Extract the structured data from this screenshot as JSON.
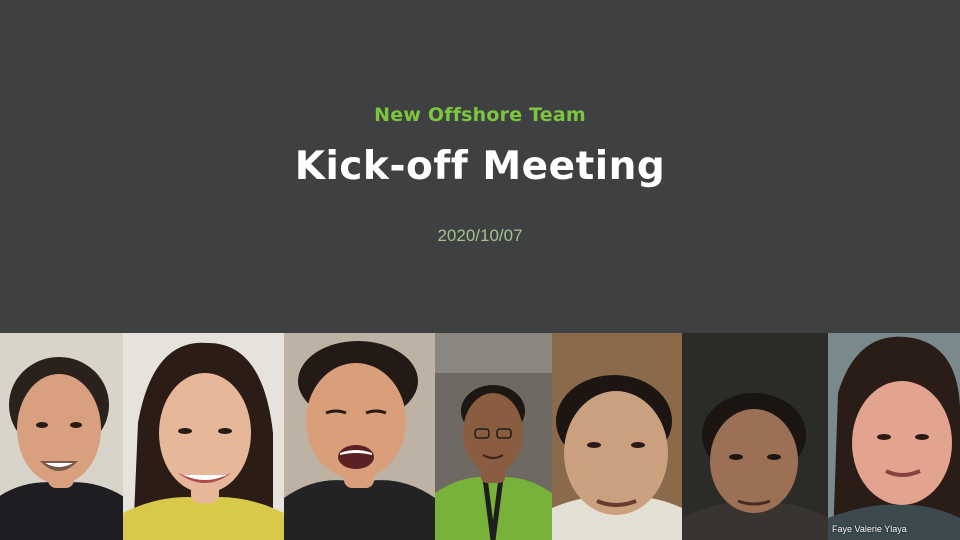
{
  "slide": {
    "subtitle": "New Offshore Team",
    "title": "Kick-off Meeting",
    "date": "2020/10/07"
  },
  "participants": [
    {
      "id": "p1",
      "name": "",
      "bg": "#d9d4c9",
      "skin": "#d8a07e",
      "hair": "#2a211c",
      "shirt": "#1e1e22"
    },
    {
      "id": "p2",
      "name": "",
      "bg": "#e6e2dc",
      "skin": "#e7b79a",
      "hair": "#2b1c16",
      "shirt": "#d9c94a"
    },
    {
      "id": "p3",
      "name": "",
      "bg": "#bdb2a4",
      "skin": "#d99e7a",
      "hair": "#231a16",
      "shirt": "#232325"
    },
    {
      "id": "p4",
      "name": "",
      "bg": "#6e6a63",
      "skin": "#8a5c40",
      "hair": "#1d1714",
      "shirt": "#79b23a"
    },
    {
      "id": "p5",
      "name": "",
      "bg": "#8a6a4a",
      "skin": "#caa07e",
      "hair": "#1c1512",
      "shirt": "#e4e0d6"
    },
    {
      "id": "p6",
      "name": "",
      "bg": "#2b2b28",
      "skin": "#9b7055",
      "hair": "#1b1512",
      "shirt": "#3a3430"
    },
    {
      "id": "p7",
      "name": "Faye Valerie Ylaya",
      "bg": "#7a8a8c",
      "skin": "#e2a48f",
      "hair": "#2a1d18",
      "shirt": "#3c4a50"
    }
  ]
}
